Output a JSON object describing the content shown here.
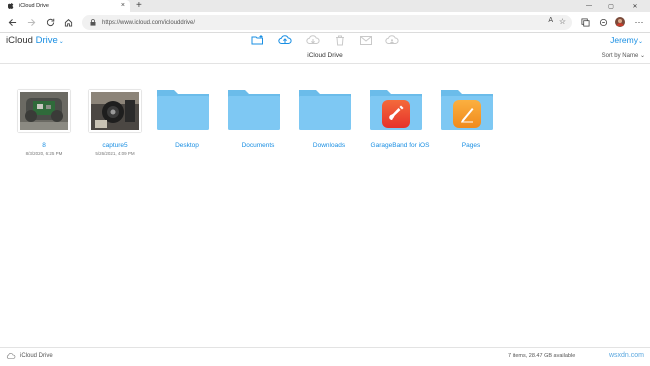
{
  "browser": {
    "tab_title": "iCloud Drive",
    "tab_close": "×",
    "new_tab": "+",
    "url": "https://www.icloud.com/iclouddrive/",
    "window_controls": [
      "—",
      "▢",
      "✕"
    ]
  },
  "app": {
    "brand_prefix": "iCloud",
    "brand_drive": "Drive",
    "brand_chevron": "⌄",
    "user_name": "Jeremy",
    "user_chevron": "⌄",
    "location_title": "iCloud Drive",
    "sort_label": "Sort by Name",
    "sort_chevron": "⌄",
    "toolbar": [
      "new-folder-icon",
      "upload-icon",
      "download-icon",
      "trash-icon",
      "mail-icon",
      "share-icon"
    ]
  },
  "items": [
    {
      "name": "8",
      "date": "8/3/2020, 6:25 PM",
      "kind": "image"
    },
    {
      "name": "capture5",
      "date": "5/26/2021, 4:09 PM",
      "kind": "image"
    },
    {
      "name": "Desktop",
      "kind": "folder"
    },
    {
      "name": "Documents",
      "kind": "folder"
    },
    {
      "name": "Downloads",
      "kind": "folder"
    },
    {
      "name": "GarageBand for iOS",
      "kind": "folder",
      "badge": "garageband-icon"
    },
    {
      "name": "Pages",
      "kind": "folder",
      "badge": "pages-icon"
    }
  ],
  "footer": {
    "drive_label": "iCloud Drive",
    "stats": "7 items, 28.47 GB available",
    "watermark": "wsxdn.com"
  },
  "colors": {
    "accent": "#1a8fe3",
    "folder": "#7ec8f3",
    "folder_tab": "#6bbcea"
  }
}
